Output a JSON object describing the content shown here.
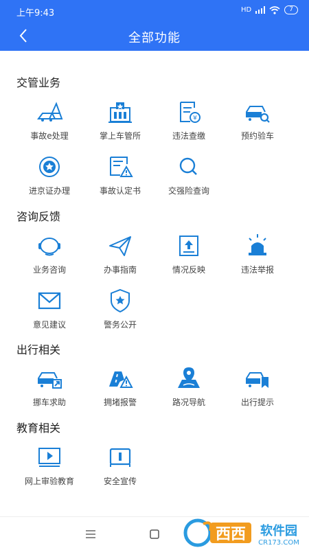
{
  "status": {
    "time": "上午9:43",
    "signal": "HD",
    "battery": "7"
  },
  "header": {
    "title": "全部功能"
  },
  "sections": [
    {
      "title": "交管业务",
      "items": [
        "事故e处理",
        "掌上车管所",
        "违法查缴",
        "预约验车",
        "进京证办理",
        "事故认定书",
        "交强险查询"
      ]
    },
    {
      "title": "咨询反馈",
      "items": [
        "业务咨询",
        "办事指南",
        "情况反映",
        "违法举报",
        "意见建议",
        "警务公开"
      ]
    },
    {
      "title": "出行相关",
      "items": [
        "挪车求助",
        "拥堵报警",
        "路况导航",
        "出行提示"
      ]
    },
    {
      "title": "教育相关",
      "items": [
        "网上审验教育",
        "安全宣传"
      ]
    }
  ],
  "colors": {
    "primary": "#2f73f5",
    "icon": "#1a7fd6"
  },
  "watermark": {
    "text1": "西西",
    "text2": "软件园",
    "domain": "CR173.COM"
  }
}
